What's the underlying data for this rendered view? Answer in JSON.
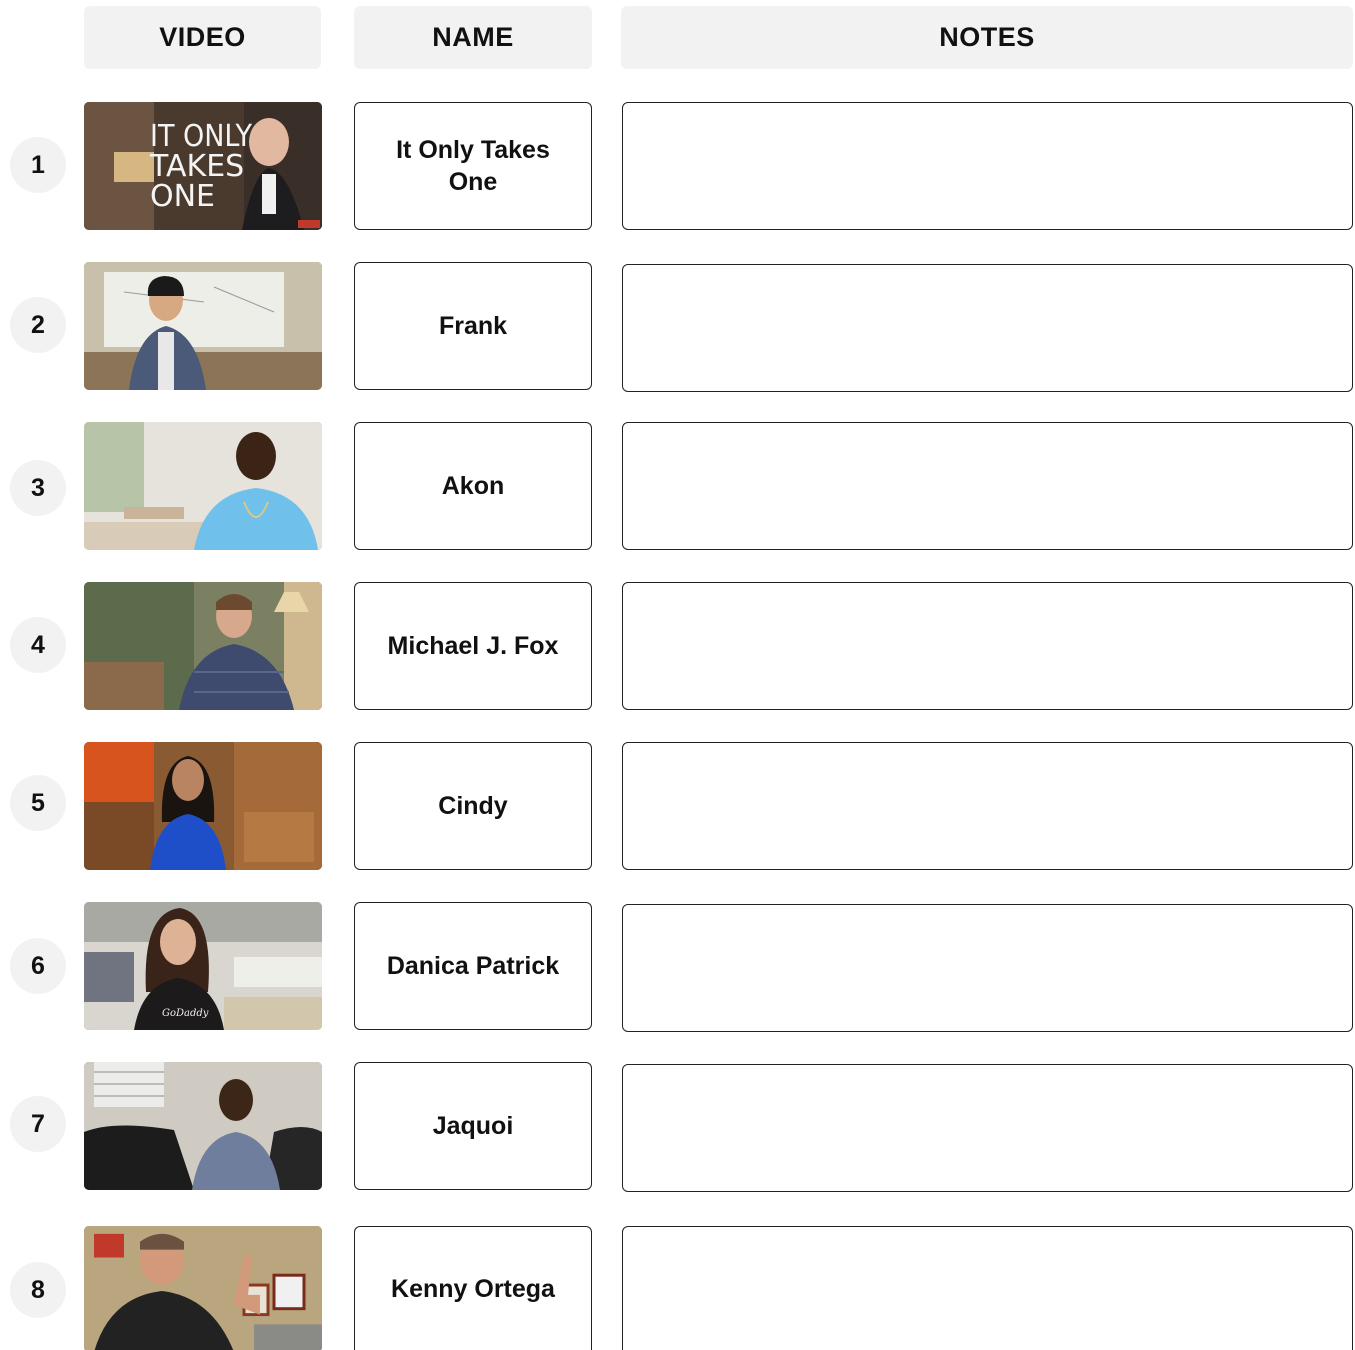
{
  "headers": {
    "video": "VIDEO",
    "name": "NAME",
    "notes": "NOTES"
  },
  "rows": [
    {
      "number": "1",
      "name": "It Only Takes One",
      "thumb_text": "IT ONLY TAKES ONE",
      "notes": ""
    },
    {
      "number": "2",
      "name": "Frank",
      "notes": ""
    },
    {
      "number": "3",
      "name": "Akon",
      "notes": ""
    },
    {
      "number": "4",
      "name": "Michael J. Fox",
      "notes": ""
    },
    {
      "number": "5",
      "name": "Cindy",
      "notes": ""
    },
    {
      "number": "6",
      "name": "Danica Patrick",
      "thumb_text": "GoDaddy",
      "notes": ""
    },
    {
      "number": "7",
      "name": "Jaquoi",
      "notes": ""
    },
    {
      "number": "8",
      "name": "Kenny Ortega",
      "notes": ""
    }
  ]
}
